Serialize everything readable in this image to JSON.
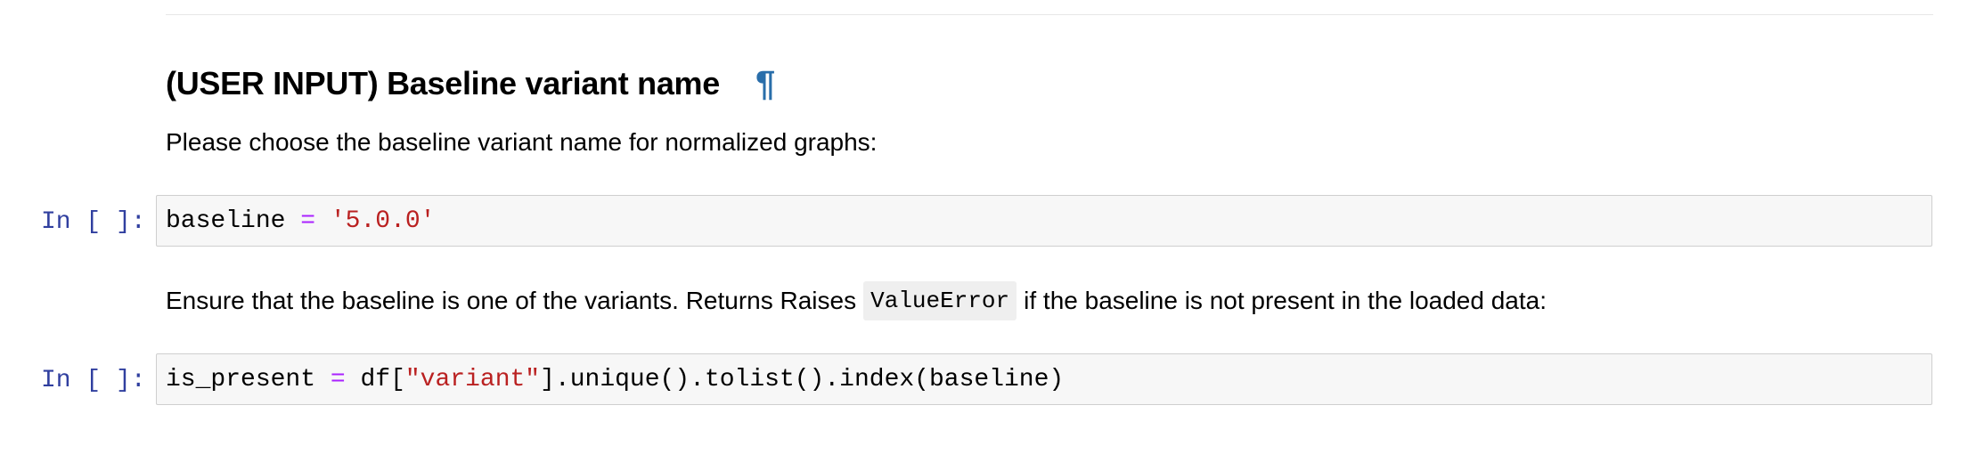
{
  "heading": {
    "title": "(USER INPUT) Baseline variant name",
    "anchor": "¶"
  },
  "markdown": {
    "p1": "Please choose the baseline variant name for normalized graphs:",
    "p2_before": "Ensure that the baseline is one of the variants. Returns Raises",
    "p2_code": "ValueError",
    "p2_after": "if the baseline is not present in the loaded data:"
  },
  "cells": [
    {
      "prompt": "In [ ]:",
      "tokens": {
        "t1": "baseline ",
        "t2": "=",
        "t3": " ",
        "t4": "'5.0.0'"
      }
    },
    {
      "prompt": "In [ ]:",
      "tokens": {
        "t1": "is_present ",
        "t2": "=",
        "t3": " df[",
        "t4": "\"variant\"",
        "t5": "].unique().tolist().index(baseline)"
      }
    }
  ],
  "colors": {
    "prompt": "#303f9f",
    "operator": "#aa22ff",
    "string": "#ba2121",
    "anchor": "#296eaa",
    "cell_bg": "#f7f7f7",
    "cell_border": "#cfcfcf"
  }
}
